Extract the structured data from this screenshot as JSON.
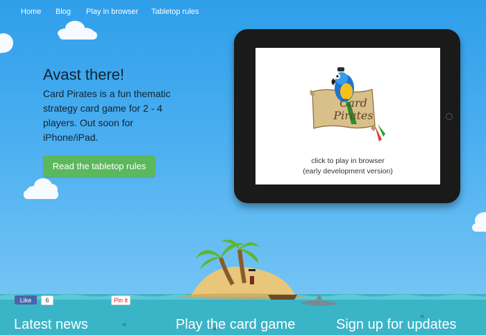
{
  "nav": {
    "items": [
      "Home",
      "Blog",
      "Play in browser",
      "Tabletop rules"
    ]
  },
  "hero": {
    "title": "Avast there!",
    "text": "Card Pirates is a fun thematic strategy card game for 2 - 4 players. Out soon for iPhone/iPad.",
    "button": "Read the tabletop rules"
  },
  "ipad": {
    "logo_line1": "Card",
    "logo_line2": "Pirates",
    "play_text": "click to play in browser",
    "play_subtext": "(early development version)"
  },
  "social": {
    "like_label": "Like",
    "like_count": "6",
    "pin_label": "Pin it"
  },
  "sections": [
    "Latest news",
    "Play the card game",
    "Sign up for updates"
  ],
  "colors": {
    "sky": "#49aef0",
    "button_green": "#5cb85c",
    "sea": "#3fb8c8",
    "text_dark": "#112233"
  }
}
